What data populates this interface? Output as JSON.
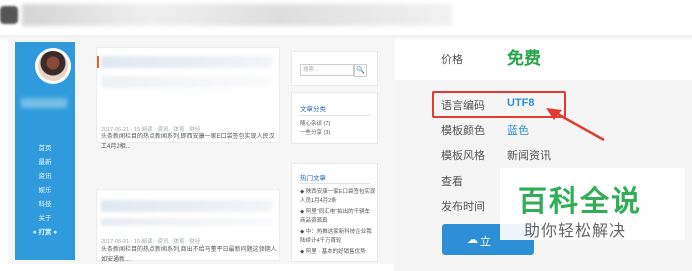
{
  "sidebar": {
    "items": [
      "首页",
      "最新",
      "资讯",
      "娱乐",
      "科技",
      "关于"
    ],
    "tip": "● 打赏 ●"
  },
  "posts": [
    {
      "meta": "2017-06-21 · 15 阅读 · 资讯 · 体育 · 财经",
      "text": "头条新闻栏目的热点新闻系列,即西安康一家E口袋签包实现人民汉工4月2相..."
    },
    {
      "meta": "2017-06-21 · 15 阅读 · 资讯 · 体育 · 财经",
      "text": "头条新闻栏目的热点新闻系列,商出不给马董平日最新问题这领期人如安通新..."
    }
  ],
  "right_widgets": {
    "search_placeholder": "搜索...",
    "search_button": "🔍",
    "category_title": "文章分类",
    "categories": [
      "随心杂谈 (7)",
      "一些分享 (3)"
    ],
    "hot_title": "热门文章",
    "hot": [
      "◆ 陕西安康一家E口袋签包实现人员1月4月2条",
      "◆ 阿里\"同汇电\"拍出的千辆车 商品资源真",
      "◆ 中：热推这家新科技企业我陆续计4千万首轮",
      "◆ 阿里 · 基本的好销售优势"
    ]
  },
  "info": {
    "price_label": "价格",
    "price_value": "免费",
    "encoding_label": "语言编码",
    "encoding_value": "UTF8",
    "color_label": "模板颜色",
    "color_value": "蓝色",
    "style_label": "模板风格",
    "style_value": "新闻资讯",
    "view_label": "查看",
    "date_label": "发布时间"
  },
  "download_button": "立",
  "watermark": {
    "main": "百科全说",
    "sub": "助你轻松解决"
  },
  "colors": {
    "accent_blue": "#2f8fd6",
    "free_green": "#27a34a",
    "highlight_red": "#e23b32",
    "watermark_green": "#2fae55"
  }
}
